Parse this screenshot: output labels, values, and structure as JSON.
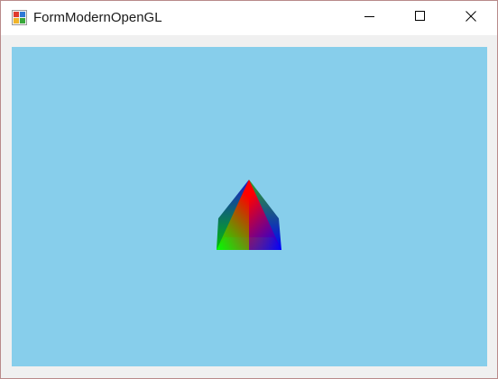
{
  "window": {
    "title": "FormModernOpenGL",
    "app_icon": "winforms-app-icon",
    "controls": {
      "minimize_icon": "minimize-icon",
      "maximize_icon": "maximize-icon",
      "close_icon": "close-icon"
    }
  },
  "viewport": {
    "background_color": "#87ceeb",
    "object": {
      "shape": "pyramid",
      "vertex_colors": [
        "#ff0000",
        "#00ff00",
        "#0000ff"
      ]
    }
  }
}
